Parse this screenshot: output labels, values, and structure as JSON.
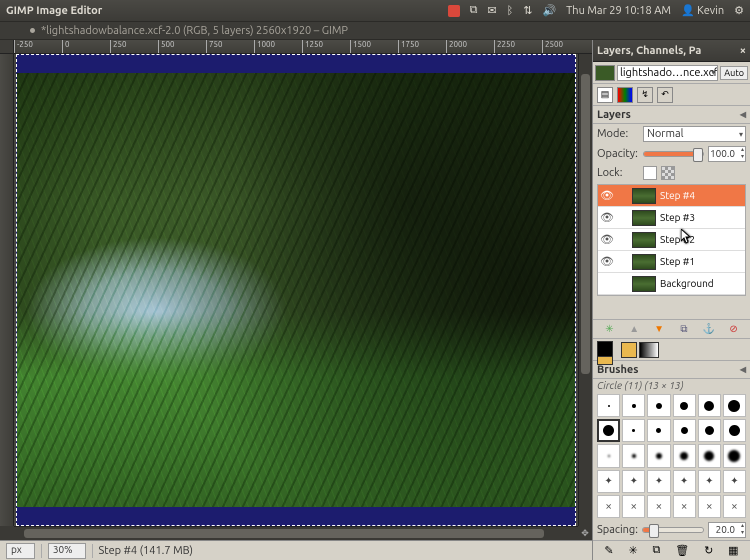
{
  "os": {
    "app_title": "GIMP Image Editor",
    "clock": "Thu Mar 29 10:18 AM",
    "user": "Kevin"
  },
  "doc": {
    "title": "*lightshadowbalance.xcf-2.0 (RGB, 5 layers) 2560x1920 – GIMP"
  },
  "ruler_ticks": [
    "-250",
    "0",
    "250",
    "500",
    "750",
    "1000",
    "1250",
    "1500",
    "1750",
    "2000",
    "2250",
    "2500"
  ],
  "status": {
    "unit": "px",
    "zoom": "30%",
    "info": "Step #4 (141.7 MB)"
  },
  "dock": {
    "tab_title": "Layers, Channels, Pa",
    "image_selector": "lightshado…nce.xcf-2",
    "auto_btn": "Auto",
    "layers_label": "Layers",
    "mode_label": "Mode:",
    "mode_value": "Normal",
    "opacity_label": "Opacity:",
    "opacity_value": "100.0",
    "lock_label": "Lock:",
    "layers": [
      {
        "name": "Step #4",
        "visible": true,
        "selected": true
      },
      {
        "name": "Step #3",
        "visible": true,
        "selected": false
      },
      {
        "name": "Step #2",
        "visible": true,
        "selected": false
      },
      {
        "name": "Step #1",
        "visible": true,
        "selected": false
      },
      {
        "name": "Background",
        "visible": false,
        "selected": false
      }
    ],
    "brushes_label": "Brushes",
    "brush_sub": "Circle (11) (13 × 13)",
    "spacing_label": "Spacing:",
    "spacing_value": "20.0"
  }
}
